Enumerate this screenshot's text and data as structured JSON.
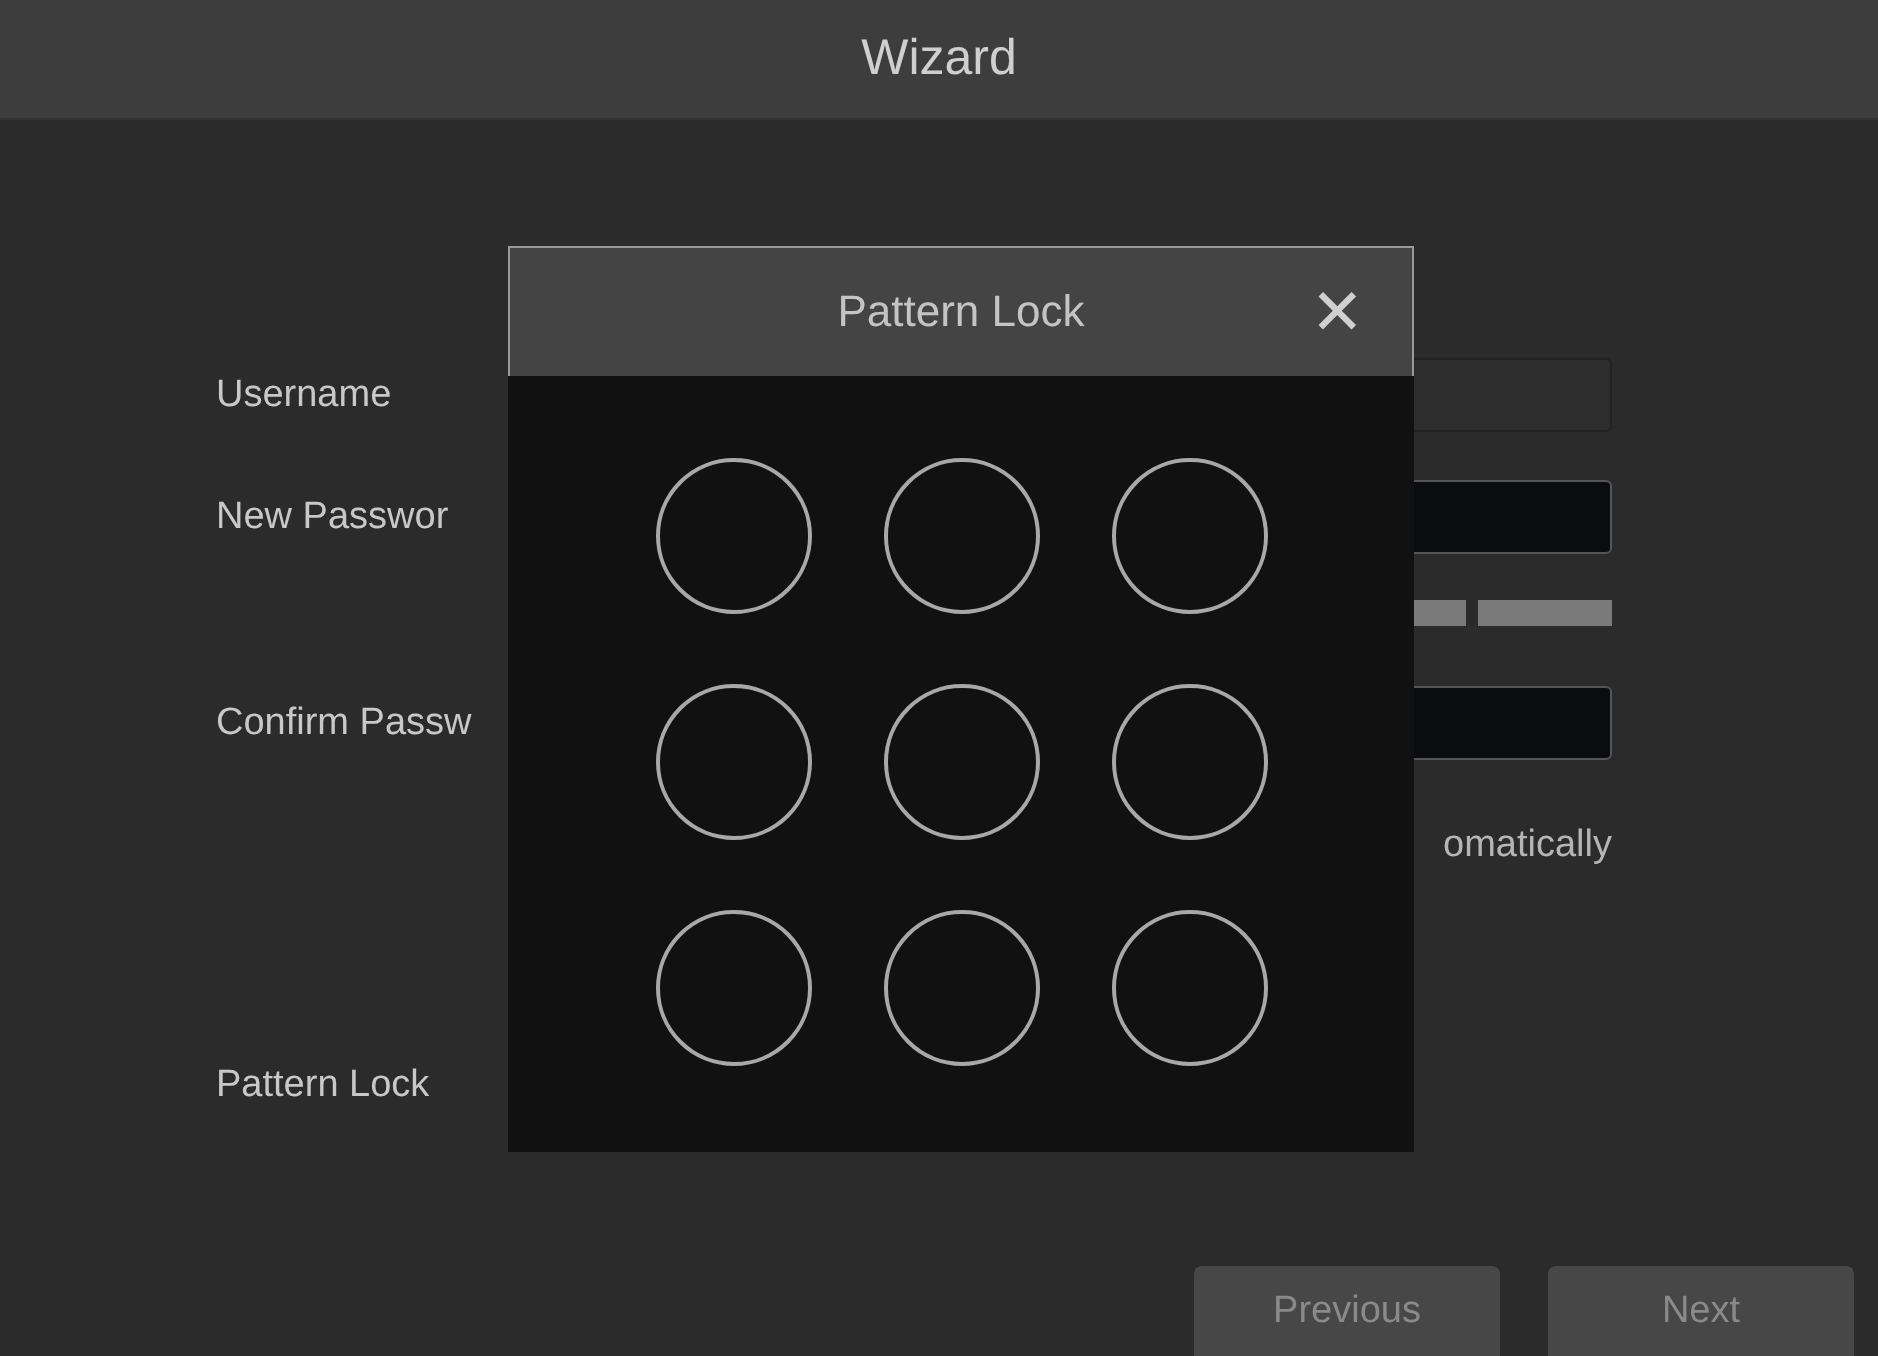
{
  "window": {
    "title": "Wizard"
  },
  "form": {
    "labels": [
      "Username",
      "New Passwor",
      "Confirm Passw",
      "Pattern Lock"
    ],
    "auto_option": "omatically"
  },
  "buttons": [
    "Previous",
    "Next"
  ],
  "dialog": {
    "title": "Pattern Lock",
    "close": "✕"
  }
}
